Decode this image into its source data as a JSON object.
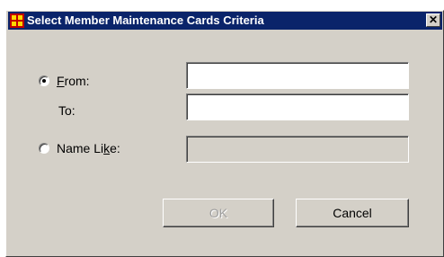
{
  "window": {
    "title": "Select Member Maintenance Cards Criteria",
    "close_glyph": "✕",
    "icon": "app-grid-icon"
  },
  "form": {
    "from": {
      "label_prefix": "",
      "mnemonic": "F",
      "label_rest": "rom:",
      "selected": true,
      "value": ""
    },
    "to": {
      "label": "To:",
      "value": ""
    },
    "name_like": {
      "label_prefix": "Name Li",
      "mnemonic": "k",
      "label_rest": "e:",
      "selected": false,
      "value": ""
    }
  },
  "buttons": {
    "ok": {
      "label": "OK",
      "enabled": false
    },
    "cancel": {
      "label": "Cancel",
      "enabled": true
    }
  },
  "colors": {
    "titlebar": "#0a246a",
    "dialog_bg": "#d4d0c8"
  }
}
